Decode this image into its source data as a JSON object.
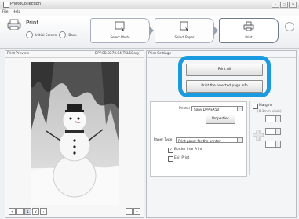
{
  "window": {
    "title": "PhotoCollection"
  },
  "menu": {
    "items": [
      "File",
      "Help"
    ]
  },
  "toolbar": {
    "print_title": "Print",
    "initial_screen_label": "Initial Screen",
    "back_label": "Back",
    "steps": [
      {
        "label": "Select Photo",
        "icon": "select-photo-icon"
      },
      {
        "label": "Select Paper",
        "icon": "select-paper-icon"
      },
      {
        "label": "Print",
        "icon": "printer-icon"
      }
    ]
  },
  "preview": {
    "title": "Print Preview",
    "photo_info": "DPP.0B.0270.04(TSL5Gary)",
    "page_buttons": [
      "1",
      "2"
    ]
  },
  "settings": {
    "title": "Print Settings",
    "print_all_label": "Print All",
    "print_selected_label": "Print the selected page info",
    "printer_label": "Printer",
    "printer_value": "Sony DPP-EX50",
    "properties_label": "Properties",
    "paper_type_label": "Paper Type",
    "paper_type_value": "Print paper for the printer",
    "borderless_label": "Border free Print",
    "borderless_checked": true,
    "exif_label": "Exif Print",
    "exif_checked": false,
    "margins_label": "Margins",
    "margins_unit": "(0.1mm pitch)"
  },
  "colors": {
    "highlight": "#1a9be0"
  }
}
